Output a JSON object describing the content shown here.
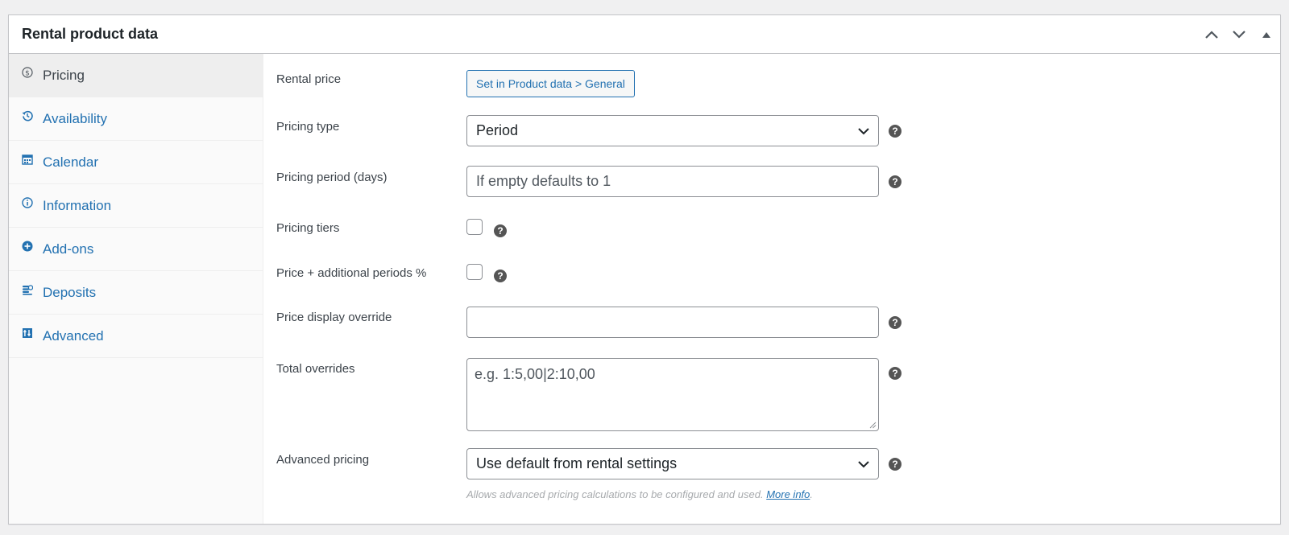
{
  "panel": {
    "title": "Rental product data"
  },
  "sidebar": {
    "tabs": [
      {
        "label": "Pricing",
        "icon": "dollar-circle-icon",
        "active": true
      },
      {
        "label": "Availability",
        "icon": "history-icon"
      },
      {
        "label": "Calendar",
        "icon": "calendar-icon"
      },
      {
        "label": "Information",
        "icon": "info-icon"
      },
      {
        "label": "Add-ons",
        "icon": "plus-circle-icon"
      },
      {
        "label": "Deposits",
        "icon": "coins-icon"
      },
      {
        "label": "Advanced",
        "icon": "sliders-icon"
      }
    ]
  },
  "form": {
    "rental_price": {
      "label": "Rental price",
      "button": "Set in Product data > General"
    },
    "pricing_type": {
      "label": "Pricing type",
      "value": "Period"
    },
    "pricing_period": {
      "label": "Pricing period (days)",
      "placeholder": "If empty defaults to 1"
    },
    "pricing_tiers": {
      "label": "Pricing tiers"
    },
    "additional_periods": {
      "label": "Price + additional periods %"
    },
    "price_display_override": {
      "label": "Price display override",
      "value": ""
    },
    "total_overrides": {
      "label": "Total overrides",
      "placeholder": "e.g. 1:5,00|2:10,00"
    },
    "advanced_pricing": {
      "label": "Advanced pricing",
      "value": "Use default from rental settings",
      "description": "Allows advanced pricing calculations to be configured and used.",
      "link": "More info",
      "period": "."
    },
    "help_glyph": "?"
  },
  "colors": {
    "link": "#2271b1",
    "border": "#c3c4c7",
    "help": "#555555"
  }
}
